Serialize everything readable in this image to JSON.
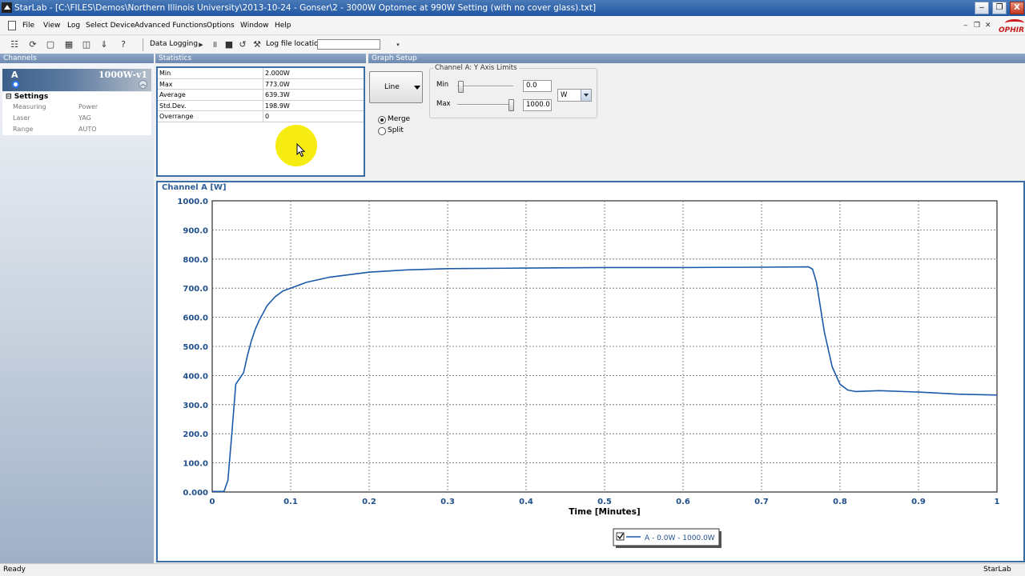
{
  "window": {
    "title": "StarLab - [C:\\FILES\\Demos\\Northern Illinois University\\2013-10-24 - Gonser\\2 - 3000W Optomec at 990W Setting (with no cover glass).txt]",
    "minimize": "‒",
    "maximize": "❐",
    "close": "X"
  },
  "menu": {
    "items": [
      "File",
      "View",
      "Log",
      "Select Device",
      "Advanced Functions",
      "Options",
      "Window",
      "Help"
    ],
    "mdi": [
      "‒",
      "❐",
      "✕"
    ],
    "logo": "OPHIR"
  },
  "toolbar": {
    "data_logging": "Data Logging",
    "log_file_location": "Log file location",
    "log_file_value": ""
  },
  "channels": {
    "header": "Channels",
    "channel": {
      "letter": "A",
      "model": "1000W-v1"
    },
    "settings_title": "Settings",
    "settings": [
      {
        "key": "Measuring",
        "value": "Power"
      },
      {
        "key": "Laser",
        "value": "YAG"
      },
      {
        "key": "Range",
        "value": "AUTO"
      }
    ]
  },
  "statistics": {
    "header": "Statistics",
    "rows": [
      {
        "key": "Min",
        "value": "2.000W"
      },
      {
        "key": "Max",
        "value": "773.0W"
      },
      {
        "key": "Average",
        "value": "639.3W"
      },
      {
        "key": "Std.Dev.",
        "value": "198.9W"
      },
      {
        "key": "Overrange",
        "value": "0"
      }
    ]
  },
  "graph_setup": {
    "header": "Graph Setup",
    "graph_type": "Line",
    "modes": [
      {
        "label": "Merge",
        "selected": true
      },
      {
        "label": "Split",
        "selected": false
      }
    ],
    "ylimits_title": "Channel A: Y Axis Limits",
    "min_label": "Min",
    "min_value": "0.0",
    "max_label": "Max",
    "max_value": "1000.0",
    "unit": "W"
  },
  "chart_data": {
    "type": "line",
    "title": "Channel A [W]",
    "xlabel": "Time [Minutes]",
    "ylabel": "",
    "xlim": [
      0,
      1
    ],
    "ylim": [
      0,
      1000
    ],
    "x_ticks": [
      "0",
      "0.1",
      "0.2",
      "0.3",
      "0.4",
      "0.5",
      "0.6",
      "0.7",
      "0.8",
      "0.9",
      "1"
    ],
    "y_ticks": [
      "0.000",
      "100.0",
      "200.0",
      "300.0",
      "400.0",
      "500.0",
      "600.0",
      "700.0",
      "800.0",
      "900.0",
      "1000.0"
    ],
    "grid": true,
    "line_color": "#1a5aa8",
    "series": [
      {
        "name": "A - 0.0W - 1000.0W",
        "x": [
          0,
          0.015,
          0.02,
          0.025,
          0.03,
          0.035,
          0.04,
          0.045,
          0.05,
          0.055,
          0.06,
          0.07,
          0.08,
          0.09,
          0.1,
          0.12,
          0.15,
          0.2,
          0.25,
          0.3,
          0.4,
          0.5,
          0.6,
          0.7,
          0.76,
          0.765,
          0.77,
          0.78,
          0.79,
          0.8,
          0.81,
          0.82,
          0.85,
          0.9,
          0.95,
          1.0
        ],
        "y": [
          2,
          2,
          40,
          200,
          370,
          390,
          410,
          470,
          520,
          560,
          590,
          640,
          670,
          690,
          700,
          720,
          738,
          755,
          763,
          767,
          769,
          771,
          771,
          772,
          773,
          765,
          720,
          550,
          430,
          370,
          350,
          345,
          348,
          343,
          336,
          333
        ]
      }
    ],
    "legend": "bottom-center"
  },
  "status": {
    "left": "Ready",
    "right": "StarLab"
  }
}
